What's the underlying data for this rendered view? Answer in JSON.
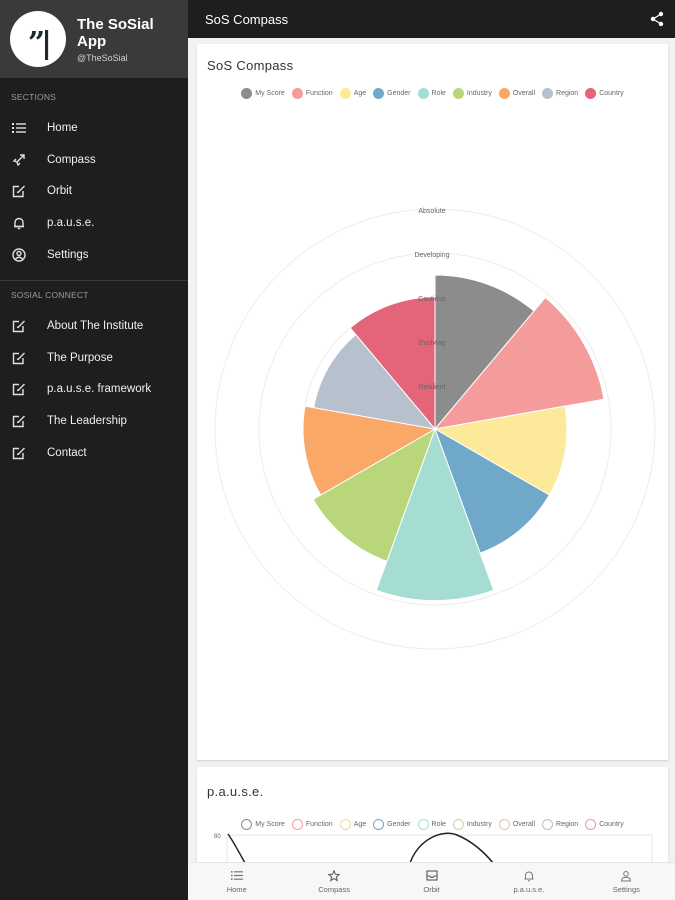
{
  "profile": {
    "app_name": "The SoSial App",
    "handle": "@TheSoSial",
    "logo_glyph": "”|"
  },
  "sidebar": {
    "sections_title": "Sections",
    "sections": [
      {
        "label": "Home",
        "icon": "list-icon"
      },
      {
        "label": "Compass",
        "icon": "rocket-icon"
      },
      {
        "label": "Orbit",
        "icon": "edit-icon"
      },
      {
        "label": "p.a.u.s.e.",
        "icon": "bell-icon"
      },
      {
        "label": "Settings",
        "icon": "user-circle-icon"
      }
    ],
    "connect_title": "SoSial Connect",
    "connect": [
      {
        "label": "About The Institute",
        "icon": "edit-icon"
      },
      {
        "label": "The Purpose",
        "icon": "edit-icon"
      },
      {
        "label": "p.a.u.s.e. framework",
        "icon": "edit-icon"
      },
      {
        "label": "The Leadership",
        "icon": "edit-icon"
      },
      {
        "label": "Contact",
        "icon": "edit-icon"
      }
    ]
  },
  "topbar": {
    "title": "SoS Compass",
    "share_icon": "share-icon"
  },
  "compass_card": {
    "title": "SoS Compass",
    "legend": [
      {
        "label": "My Score",
        "color": "#8c8c8c"
      },
      {
        "label": "Function",
        "color": "#f49c9c"
      },
      {
        "label": "Age",
        "color": "#fde99a"
      },
      {
        "label": "Gender",
        "color": "#6fa8c8"
      },
      {
        "label": "Role",
        "color": "#a6ddd3"
      },
      {
        "label": "Industry",
        "color": "#b9d77a"
      },
      {
        "label": "Overall",
        "color": "#f9a868"
      },
      {
        "label": "Region",
        "color": "#b7c0cd"
      },
      {
        "label": "Country",
        "color": "#e4657a"
      }
    ]
  },
  "chart_data": {
    "type": "polar-area",
    "categories": [
      "My Score",
      "Function",
      "Age",
      "Gender",
      "Role",
      "Industry",
      "Overall",
      "Region",
      "Country"
    ],
    "values": [
      3.5,
      3.9,
      3.0,
      3.0,
      3.9,
      3.2,
      3.0,
      2.8,
      3.0
    ],
    "scale_labels": [
      "Resilient",
      "Evolving",
      "Cautious",
      "Developing",
      "Absolute"
    ],
    "scale_values": [
      1,
      2,
      3,
      4,
      5
    ],
    "rmax": 5,
    "grid": true
  },
  "pause_card": {
    "title": "p.a.u.s.e.",
    "y_tick": "80",
    "legend": [
      {
        "label": "My Score",
        "color": "#8c8c8c"
      },
      {
        "label": "Function",
        "color": "#f49c9c"
      },
      {
        "label": "Age",
        "color": "#e6dca6"
      },
      {
        "label": "Gender",
        "color": "#6fa8c8"
      },
      {
        "label": "Role",
        "color": "#a6ddd3"
      },
      {
        "label": "Industry",
        "color": "#c9d6a8"
      },
      {
        "label": "Overall",
        "color": "#e5c29a"
      },
      {
        "label": "Region",
        "color": "#b7c0cd"
      },
      {
        "label": "Country",
        "color": "#e89aa8"
      }
    ]
  },
  "bottom_nav": [
    {
      "label": "Home",
      "icon": "list-icon"
    },
    {
      "label": "Compass",
      "icon": "star-icon"
    },
    {
      "label": "Orbit",
      "icon": "inbox-icon"
    },
    {
      "label": "p.a.u.s.e.",
      "icon": "bell-icon"
    },
    {
      "label": "Settings",
      "icon": "person-icon"
    }
  ]
}
